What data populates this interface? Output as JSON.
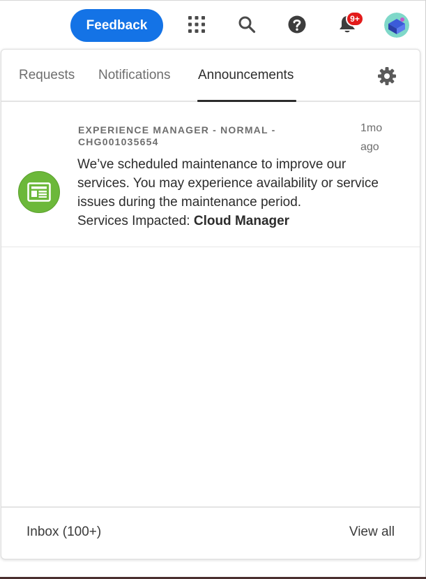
{
  "header": {
    "feedback_label": "Feedback",
    "notification_badge": "9+",
    "icons": [
      "apps-grid-icon",
      "search-icon",
      "help-icon",
      "bell-icon"
    ]
  },
  "tabs": [
    {
      "label": "Requests",
      "active": false
    },
    {
      "label": "Notifications",
      "active": false
    },
    {
      "label": "Announcements",
      "active": true
    }
  ],
  "announcement": {
    "heading": "EXPERIENCE MANAGER - NORMAL - CHG001035654",
    "time": "1mo ago",
    "body": "We’ve scheduled maintenance to improve our services. You may experience availability or service issues during the maintenance period.",
    "services_label": "Services Impacted: ",
    "services_value": "Cloud Manager",
    "icon": "announcement-icon"
  },
  "footer": {
    "inbox_label": "Inbox (100+)",
    "view_all_label": "View all"
  },
  "colors": {
    "accent": "#1473e6",
    "badge": "#e31b1b",
    "announcement_icon": "#6cb83a"
  }
}
